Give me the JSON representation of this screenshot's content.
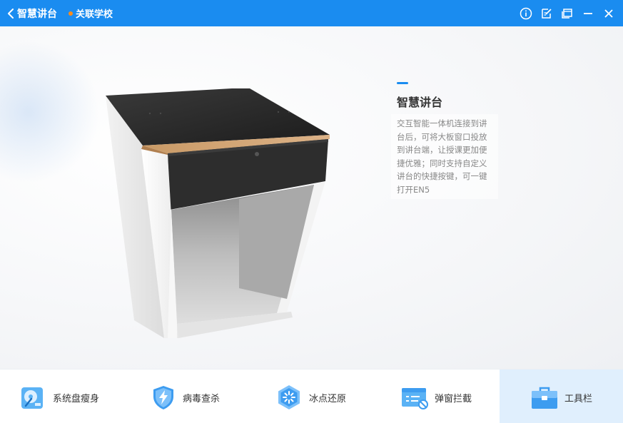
{
  "titlebar": {
    "title": "智慧讲台",
    "school_label": "关联学校",
    "school_dot_color": "#ff8c1a",
    "icons": [
      "info-icon",
      "edit-icon",
      "window-icon",
      "minimize-icon",
      "close-icon"
    ]
  },
  "feature": {
    "heading": "智慧讲台",
    "description_lines": [
      "交互智能一体机连接到讲",
      "台后，可将大板窗口投放",
      "到讲台端，让授课更加便",
      "捷优雅；同时支持自定义",
      "讲台的快捷按键，可一键",
      "打开EN5"
    ],
    "accent_color": "#1a8cf0",
    "image": "smart-podium"
  },
  "toolbar": {
    "items": [
      {
        "label": "系统盘瘦身",
        "icon": "disk-cleanup-icon",
        "active": false
      },
      {
        "label": "病毒查杀",
        "icon": "shield-icon",
        "active": false
      },
      {
        "label": "冰点还原",
        "icon": "snowflake-icon",
        "active": false
      },
      {
        "label": "弹窗拦截",
        "icon": "popup-block-icon",
        "active": false
      },
      {
        "label": "工具栏",
        "icon": "toolbox-icon",
        "active": true
      }
    ]
  },
  "colors": {
    "titlebar_bg": "#1a8cf0",
    "active_tool_bg": "#e0effd"
  }
}
